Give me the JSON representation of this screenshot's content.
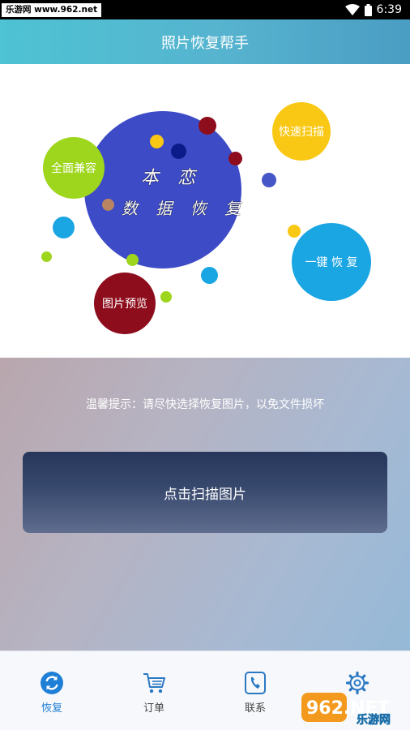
{
  "status_bar": {
    "watermark": "乐游网 www.962.net",
    "time": "6:39"
  },
  "header": {
    "title": "照片恢复帮手"
  },
  "bubbles": {
    "center_line1": "本 恋",
    "center_line2": "数 据 恢 复",
    "full_compat": "全面兼容",
    "fast_scan": "快速扫描",
    "one_key": "一键 恢 复",
    "preview": "图片预览"
  },
  "main": {
    "tip": "温馨提示：请尽快选择恢复图片，以免文件损坏",
    "scan_button": "点击扫描图片"
  },
  "nav": [
    {
      "label": "恢复",
      "icon": "refresh-icon",
      "active": true
    },
    {
      "label": "订单",
      "icon": "cart-icon",
      "active": false
    },
    {
      "label": "联系",
      "icon": "phone-icon",
      "active": false
    },
    {
      "label": "",
      "icon": "gear-icon",
      "active": false
    }
  ],
  "watermark_logo": {
    "brand": "962.NET",
    "name": "乐游网"
  },
  "colors": {
    "header": "#56b3cf",
    "center_bubble": "#3d4bc6",
    "full_compat": "#9ed61d",
    "fast_scan": "#f9c814",
    "one_key": "#1aa5e3",
    "preview": "#8e0d1c",
    "nav_active": "#1e7fd6",
    "scan_button": "#2f3e63"
  }
}
